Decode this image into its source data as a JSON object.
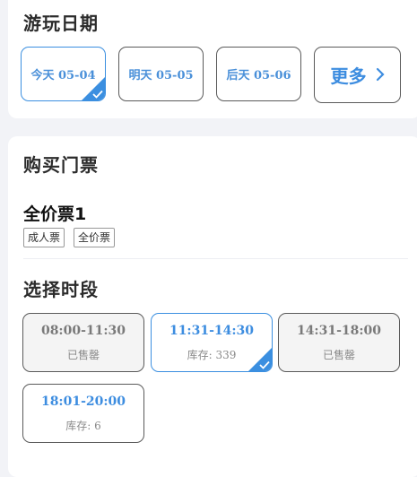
{
  "visit_date": {
    "heading": "游玩日期",
    "options": [
      {
        "label": "今天 05-04",
        "selected": true
      },
      {
        "label": "明天 05-05",
        "selected": false
      },
      {
        "label": "后天 05-06",
        "selected": false
      }
    ],
    "more_label": "更多"
  },
  "buy_tickets": {
    "heading": "购买门票",
    "ticket": {
      "name": "全价票1",
      "tags": [
        "成人票",
        "全价票"
      ]
    }
  },
  "time_slot": {
    "heading": "选择时段",
    "slots": [
      {
        "time": "08:00-11:30",
        "status": "已售罄",
        "state": "soldout"
      },
      {
        "time": "11:31-14:30",
        "status": "库存: 339",
        "state": "selected"
      },
      {
        "time": "14:31-18:00",
        "status": "已售罄",
        "state": "soldout"
      },
      {
        "time": "18:01-20:00",
        "status": "库存: 6",
        "state": "available"
      }
    ]
  },
  "colors": {
    "accent": "#3b8fe0",
    "soldout_bg": "#f4f4f4",
    "page_bg": "#f2f3f7"
  },
  "icons": {
    "more": "chevron-right-icon",
    "selected": "checkmark-icon"
  }
}
